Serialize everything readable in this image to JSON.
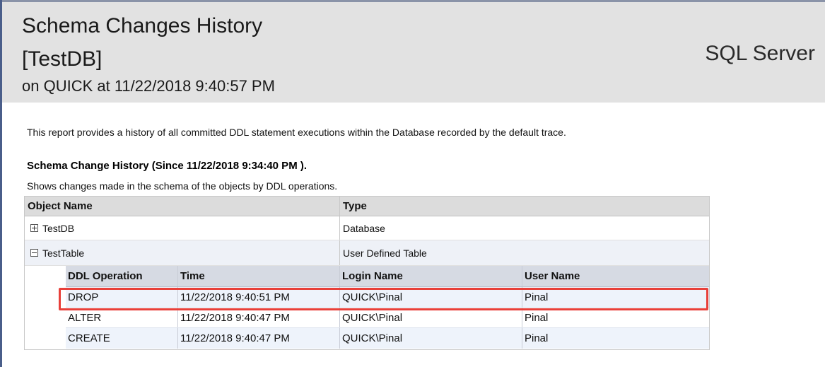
{
  "header": {
    "title": "Schema Changes History",
    "database": "[TestDB]",
    "subtitle": "on QUICK at 11/22/2018 9:40:57 PM",
    "product": "SQL Server"
  },
  "report": {
    "description": "This report provides a history of all committed DDL statement executions within the Database recorded by the default trace.",
    "section_title": "Schema Change History (Since 11/22/2018 9:34:40 PM ).",
    "section_subtitle": "Shows changes made in the schema of the objects by DDL operations."
  },
  "grid": {
    "columns": [
      "Object Name",
      "Type"
    ],
    "rows": [
      {
        "name": "TestDB",
        "type": "Database",
        "expanded": false
      },
      {
        "name": "TestTable",
        "type": "User Defined Table",
        "expanded": true
      }
    ]
  },
  "details": {
    "columns": [
      "DDL Operation",
      "Time",
      "Login Name",
      "User Name"
    ],
    "rows": [
      [
        "DROP",
        "11/22/2018 9:40:51 PM",
        "QUICK\\Pinal",
        "Pinal"
      ],
      [
        "ALTER",
        "11/22/2018 9:40:47 PM",
        "QUICK\\Pinal",
        "Pinal"
      ],
      [
        "CREATE",
        "11/22/2018 9:40:47 PM",
        "QUICK\\Pinal",
        "Pinal"
      ]
    ]
  },
  "colors": {
    "header_bg": "#e2e2e2",
    "highlight": "#e8403a",
    "alt_row": "#eef3fb"
  }
}
